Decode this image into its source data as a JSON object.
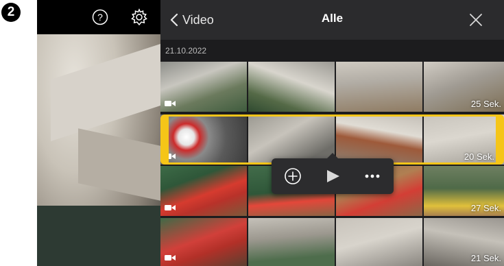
{
  "step_badge": "2",
  "colors": {
    "accent_selected": "#f5c518",
    "nav_bg": "#2b2b2d",
    "panel_bg": "#1c1c1e"
  },
  "left_toolbar": {
    "help_icon": "help-circle-icon",
    "settings_icon": "gear-icon"
  },
  "nav": {
    "back_label": "Video",
    "title": "Alle",
    "close_icon": "close-icon"
  },
  "date_header": "21.10.2022",
  "tiles": [
    {
      "duration": ""
    },
    {
      "duration": ""
    },
    {
      "duration": ""
    },
    {
      "duration": "25 Sek."
    },
    {
      "duration": ""
    },
    {
      "duration": ""
    },
    {
      "duration": ""
    },
    {
      "duration": "20 Sek."
    },
    {
      "duration": ""
    },
    {
      "duration": ""
    },
    {
      "duration": ""
    },
    {
      "duration": "27 Sek."
    },
    {
      "duration": ""
    },
    {
      "duration": ""
    },
    {
      "duration": ""
    },
    {
      "duration": "21 Sek."
    }
  ],
  "action_bar": {
    "add_icon": "add-circle-icon",
    "play_icon": "play-icon",
    "more_icon": "more-icon"
  }
}
